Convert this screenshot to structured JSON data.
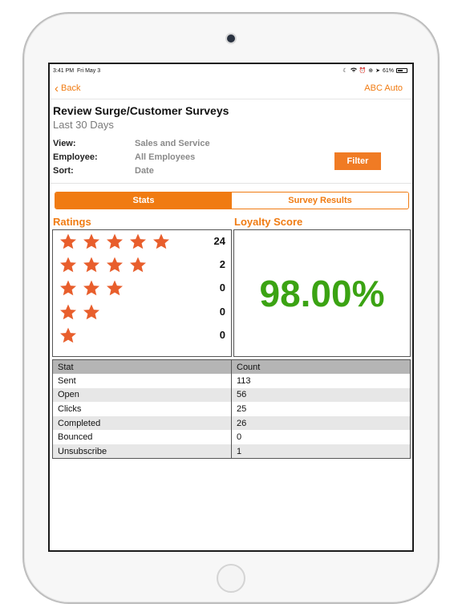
{
  "status_bar": {
    "time": "3:41 PM",
    "date": "Fri May 3",
    "battery": "61%",
    "battery_level": 0.61,
    "icons": [
      "moon-icon",
      "wifi-icon",
      "alarm-icon",
      "orientation-lock-icon",
      "location-icon"
    ]
  },
  "nav": {
    "back_label": "Back",
    "account": "ABC Auto"
  },
  "report": {
    "title": "Review Surge/Customer Surveys",
    "period": "Last 30 Days",
    "meta": [
      {
        "key": "View:",
        "value": "Sales and Service"
      },
      {
        "key": "Employee:",
        "value": "All Employees"
      },
      {
        "key": "Sort:",
        "value": "Date"
      }
    ],
    "filter_label": "Filter"
  },
  "tabs": [
    {
      "label": "Stats",
      "active": true
    },
    {
      "label": "Survey Results",
      "active": false
    }
  ],
  "ratings": {
    "label": "Ratings",
    "star_color": "#e85e2c",
    "rows": [
      {
        "stars": 5,
        "count": "24"
      },
      {
        "stars": 4,
        "count": "2"
      },
      {
        "stars": 3,
        "count": "0"
      },
      {
        "stars": 2,
        "count": "0"
      },
      {
        "stars": 1,
        "count": "0"
      }
    ]
  },
  "loyalty": {
    "label": "Loyalty Score",
    "value": "98.00%",
    "color": "#3ba313"
  },
  "stats_table": {
    "headers": [
      "Stat",
      "Count"
    ],
    "rows": [
      {
        "stat": "Sent",
        "count": "113"
      },
      {
        "stat": "Open",
        "count": "56"
      },
      {
        "stat": "Clicks",
        "count": "25"
      },
      {
        "stat": "Completed",
        "count": "26"
      },
      {
        "stat": "Bounced",
        "count": "0"
      },
      {
        "stat": "Unsubscribe",
        "count": "1"
      }
    ]
  },
  "colors": {
    "accent": "#f07b12",
    "filter_button": "#f07b24",
    "table_header": "#b5b5b5",
    "table_alt_row": "#e7e7e7"
  }
}
